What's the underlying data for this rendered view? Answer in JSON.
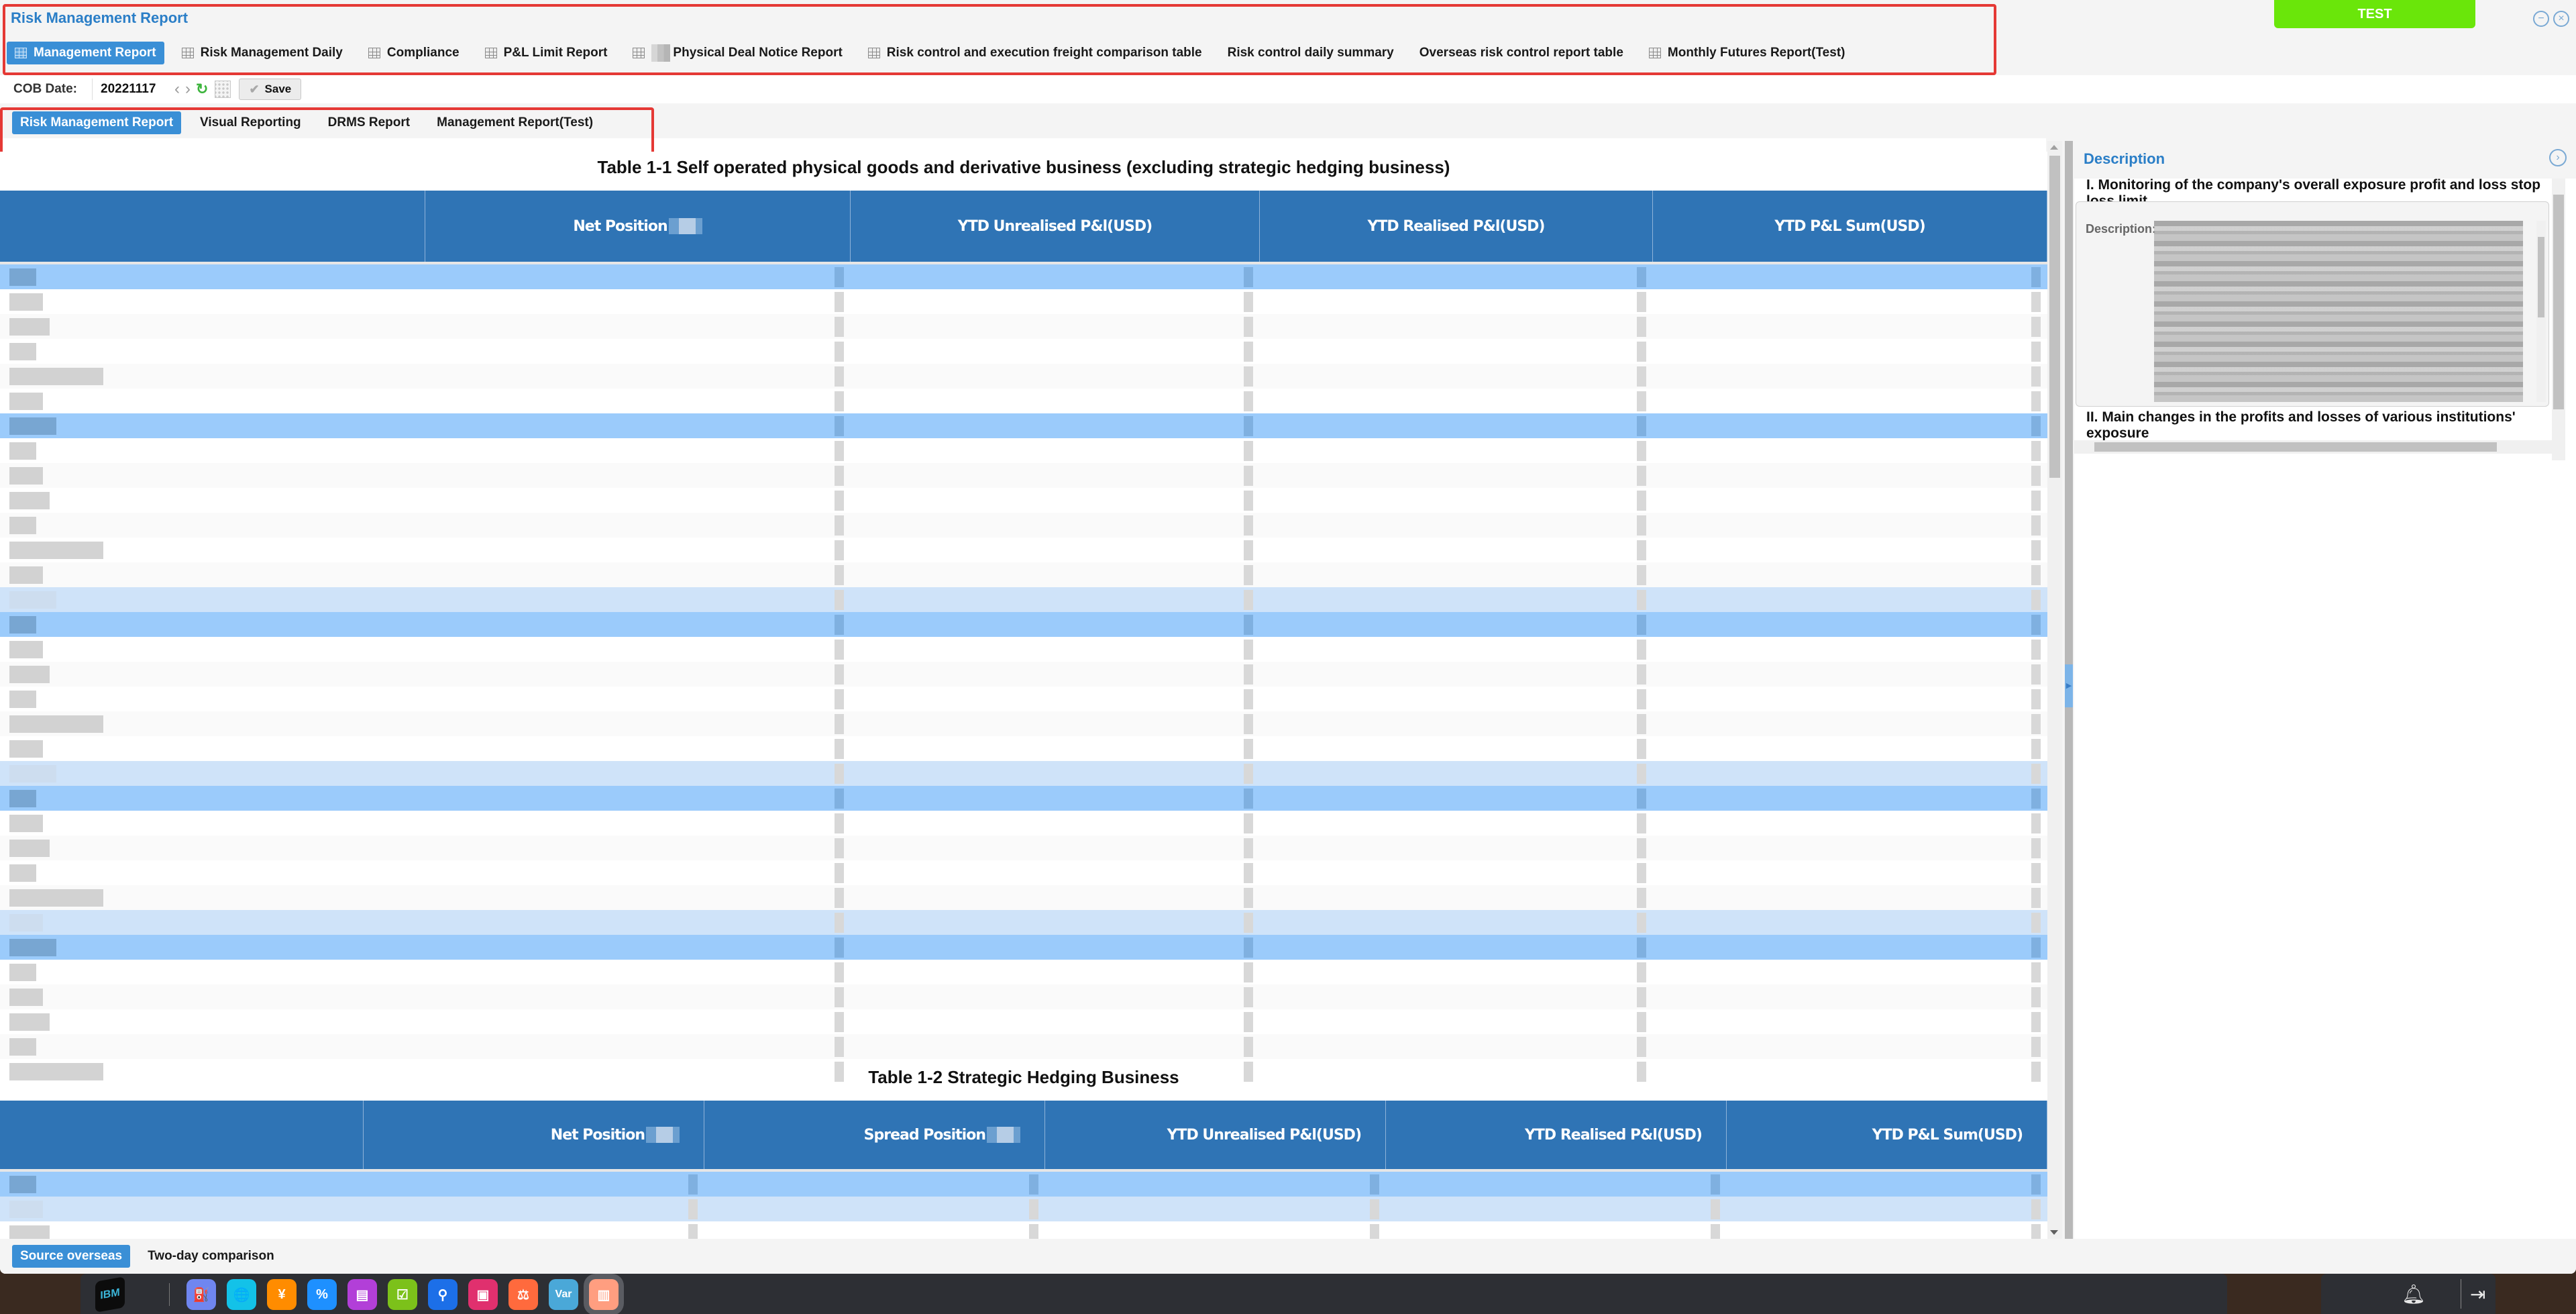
{
  "app": {
    "title": "Risk Management Report",
    "env_badge": "TEST",
    "window_controls": {
      "minimize_icon": "minus-circle-icon",
      "close_icon": "close-circle-icon"
    }
  },
  "top_tabs": [
    {
      "label": "Management Report",
      "icon": "grid-icon",
      "active": true,
      "redacted_prefix": false
    },
    {
      "label": "Risk Management Daily",
      "icon": "grid-icon",
      "active": false,
      "redacted_prefix": false
    },
    {
      "label": "Compliance",
      "icon": "grid-icon",
      "active": false,
      "redacted_prefix": false
    },
    {
      "label": "P&L Limit Report",
      "icon": "grid-icon",
      "active": false,
      "redacted_prefix": false
    },
    {
      "label": "Physical Deal Notice Report",
      "icon": "grid-icon",
      "active": false,
      "redacted_prefix": true
    },
    {
      "label": "Risk control and execution freight comparison table",
      "icon": "grid-icon",
      "active": false,
      "redacted_prefix": false
    },
    {
      "label": "Risk control daily summary",
      "icon": null,
      "active": false,
      "redacted_prefix": false
    },
    {
      "label": "Overseas risk control report table",
      "icon": null,
      "active": false,
      "redacted_prefix": false
    },
    {
      "label": "Monthly Futures Report(Test)",
      "icon": "grid-icon",
      "active": false,
      "redacted_prefix": false
    }
  ],
  "toolbar": {
    "cob_label": "COB Date:",
    "cob_value": "20221117",
    "prev_icon": "‹",
    "next_icon": "›",
    "refresh_icon": "↻",
    "save_label": "Save",
    "save_icon": "✔"
  },
  "sub_tabs": [
    {
      "label": "Risk Management Report",
      "active": true
    },
    {
      "label": "Visual Reporting",
      "active": false
    },
    {
      "label": "DRMS Report",
      "active": false
    },
    {
      "label": "Management Report(Test)",
      "active": false
    }
  ],
  "table1": {
    "title": "Table 1-1 Self operated physical goods and derivative business (excluding strategic hedging business)",
    "columns": [
      "",
      "Net Position",
      "YTD Unrealised P&l(USD)",
      "YTD Realised P&l(USD)",
      "YTD P&L Sum(USD)"
    ],
    "rows": [
      {
        "type": "group"
      },
      {
        "type": "odd"
      },
      {
        "type": "even"
      },
      {
        "type": "odd"
      },
      {
        "type": "even"
      },
      {
        "type": "odd"
      },
      {
        "type": "group"
      },
      {
        "type": "odd"
      },
      {
        "type": "even"
      },
      {
        "type": "odd"
      },
      {
        "type": "even"
      },
      {
        "type": "odd"
      },
      {
        "type": "even"
      },
      {
        "type": "group-lite"
      },
      {
        "type": "group"
      },
      {
        "type": "odd"
      },
      {
        "type": "even"
      },
      {
        "type": "odd"
      },
      {
        "type": "even"
      },
      {
        "type": "odd"
      },
      {
        "type": "group-lite"
      },
      {
        "type": "group"
      },
      {
        "type": "odd"
      },
      {
        "type": "even"
      },
      {
        "type": "odd"
      },
      {
        "type": "even"
      },
      {
        "type": "group-lite"
      },
      {
        "type": "group"
      },
      {
        "type": "odd"
      },
      {
        "type": "even"
      },
      {
        "type": "odd"
      },
      {
        "type": "even"
      },
      {
        "type": "odd"
      }
    ],
    "cell_values": "redacted"
  },
  "table2": {
    "title": "Table 1-2 Strategic Hedging Business",
    "columns": [
      "",
      "Net Position",
      "Spread Position",
      "YTD Unrealised P&l(USD)",
      "YTD Realised P&l(USD)",
      "YTD P&L Sum(USD)"
    ],
    "rows": [
      {
        "type": "group"
      },
      {
        "type": "group-lite"
      },
      {
        "type": "odd"
      },
      {
        "type": "even"
      },
      {
        "type": "odd"
      }
    ],
    "cell_values": "redacted"
  },
  "description_panel": {
    "title": "Description",
    "collapse_icon": "chevron-right-circle-icon",
    "sections": [
      {
        "title": "I. Monitoring of the company's overall exposure profit and loss stop loss limit",
        "field_label": "Description:",
        "field_value": "redacted"
      },
      {
        "title": "II. Main changes in the profits and losses of various institutions' exposure"
      }
    ]
  },
  "bottom_tabs": [
    {
      "label": "Source overseas",
      "active": true
    },
    {
      "label": "Two-day comparison",
      "active": false
    }
  ],
  "taskbar": {
    "logo": "IBM",
    "apps": [
      {
        "name": "oil-pump-app-icon",
        "glyph": "⛽",
        "color": "#6f86f0"
      },
      {
        "name": "globe-app-icon",
        "glyph": "🌐",
        "color": "#13c2e8"
      },
      {
        "name": "yen-app-icon",
        "glyph": "¥",
        "color": "#ff8c00"
      },
      {
        "name": "percent-chart-app-icon",
        "glyph": "%",
        "color": "#1e90ff"
      },
      {
        "name": "document-app-icon",
        "glyph": "▤",
        "color": "#b23fd8"
      },
      {
        "name": "checklist-app-icon",
        "glyph": "☑",
        "color": "#7cc11a"
      },
      {
        "name": "stamp-app-icon",
        "glyph": "⚲",
        "color": "#1c6fe8"
      },
      {
        "name": "briefcase-app-icon",
        "glyph": "▣",
        "color": "#e0306e"
      },
      {
        "name": "scale-app-icon",
        "glyph": "⚖",
        "color": "#ff6a3d"
      },
      {
        "name": "var-app-icon",
        "glyph": "Var",
        "color": "#4aa8d8"
      },
      {
        "name": "report-app-icon",
        "glyph": "▥",
        "color": "#ff9e80"
      }
    ],
    "notification_icon": "bell-icon",
    "logout_icon": "logout-icon"
  }
}
